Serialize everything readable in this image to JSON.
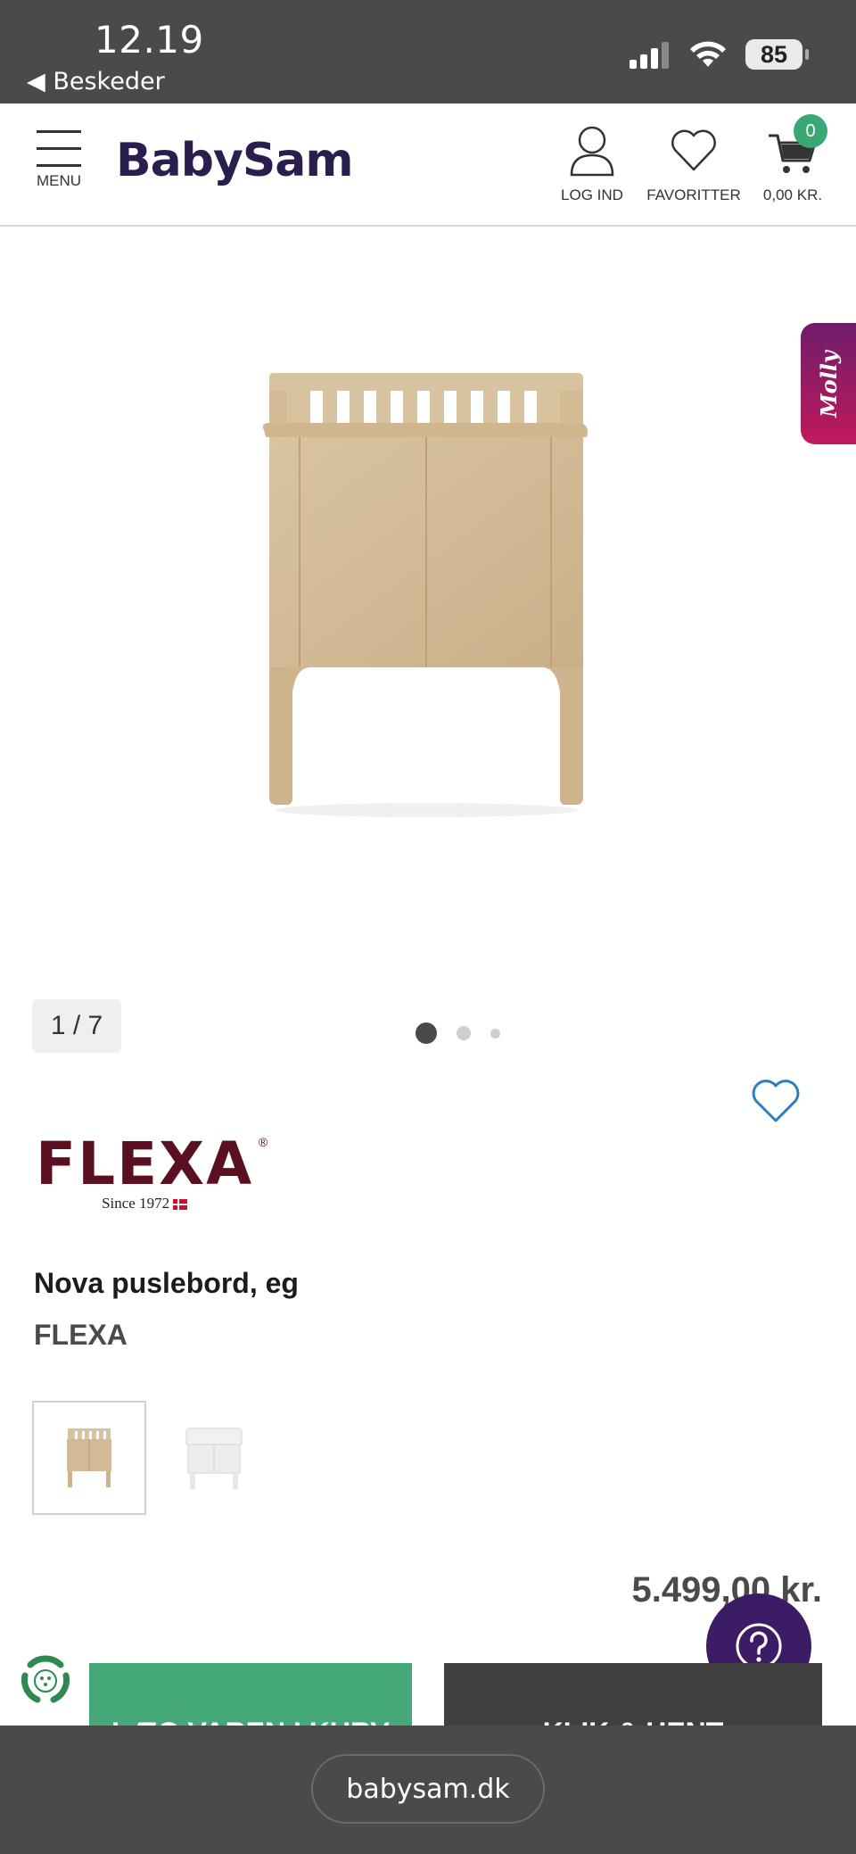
{
  "status_bar": {
    "time": "12.19",
    "back_label": "◀ Beskeder",
    "battery": "85"
  },
  "header": {
    "logo": "BabySam",
    "menu_label": "MENU",
    "login_label": "LOG IND",
    "favorites_label": "FAVORITTER",
    "cart_total": "0,00 KR.",
    "cart_count": "0"
  },
  "gallery": {
    "counter": "1 / 7",
    "side_tab": "Molly",
    "active_dot": 0,
    "dot_count": 3
  },
  "brand_logo": {
    "name": "FLEXA",
    "reg": "®",
    "since": "Since 1972"
  },
  "product": {
    "title": "Nova puslebord, eg",
    "brand": "FLEXA",
    "price": "5.499,00 kr.",
    "variants": [
      "eg",
      "hvid"
    ]
  },
  "actions": {
    "add_to_cart": "LÆG VAREN I KURV",
    "click_collect": "KLIK & HENT"
  },
  "browser": {
    "url": "babysam.dk"
  },
  "colors": {
    "brand_purple": "#2b1e4e",
    "accent_green": "#44a877",
    "help_purple": "#3d1c66",
    "heart_blue": "#2a7fc1"
  }
}
